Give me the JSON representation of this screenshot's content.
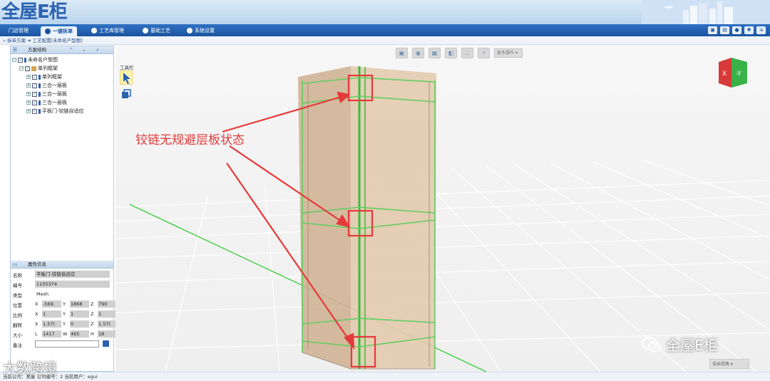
{
  "app": {
    "logo_text": "全屋E柜"
  },
  "nav": {
    "items": [
      {
        "label": "门店管理",
        "active": false
      },
      {
        "label": "一键拆单",
        "active": true
      },
      {
        "label": "工艺库管理",
        "active": false
      },
      {
        "label": "基础工艺",
        "active": false
      },
      {
        "label": "系统设置",
        "active": false
      }
    ]
  },
  "breadcrumb": {
    "text": "拆单方案 ➜ 工艺配置[未命名户型图]"
  },
  "tree_panel": {
    "title": "方案结构",
    "nodes": [
      {
        "label": "未命名户型图",
        "level": 0
      },
      {
        "label": "单列框架",
        "level": 1
      },
      {
        "label": "单列框架",
        "level": 2
      },
      {
        "label": "三合一层板",
        "level": 2
      },
      {
        "label": "三合一层板",
        "level": 2
      },
      {
        "label": "三合一层板",
        "level": 2
      },
      {
        "label": "平板门-铰链自适应",
        "level": 2
      }
    ]
  },
  "props_panel": {
    "title": "属性信息",
    "name_label": "名称",
    "name_value": "平板门-铰链自适应",
    "code_label": "编号",
    "code_value": "1155374",
    "type_label": "类型",
    "type_value": "Mesh",
    "position_label": "位置",
    "position": [
      "-569.",
      "1868",
      "790"
    ],
    "scale_label": "比例",
    "scale": [
      "1",
      "1",
      "1"
    ],
    "rotation_label": "翻转",
    "rotation": [
      "1.57(",
      "0",
      "1.57("
    ],
    "size_label": "大小",
    "size": [
      "1417",
      "465",
      "18"
    ],
    "remark_label": "备注",
    "axis_labels": [
      "X",
      "Y",
      "Z"
    ],
    "size_axis_labels": [
      "L",
      "W",
      "H"
    ]
  },
  "viewport": {
    "toolbox_label": "工具栏",
    "more_ops_label": "更多操作",
    "view_select_value": "自由视角",
    "annotation": "铰链无规避层板状态",
    "wechat_brand": "全屋E柜"
  },
  "status": {
    "text": "当前公司：美屋   公司编号：2   当前用户：egui"
  },
  "watermark": {
    "text": "大数跨境"
  },
  "colors": {
    "nav_bg": "#1b549e",
    "annotation": "#e23b3b",
    "grid_green": "#3fcf3f"
  }
}
